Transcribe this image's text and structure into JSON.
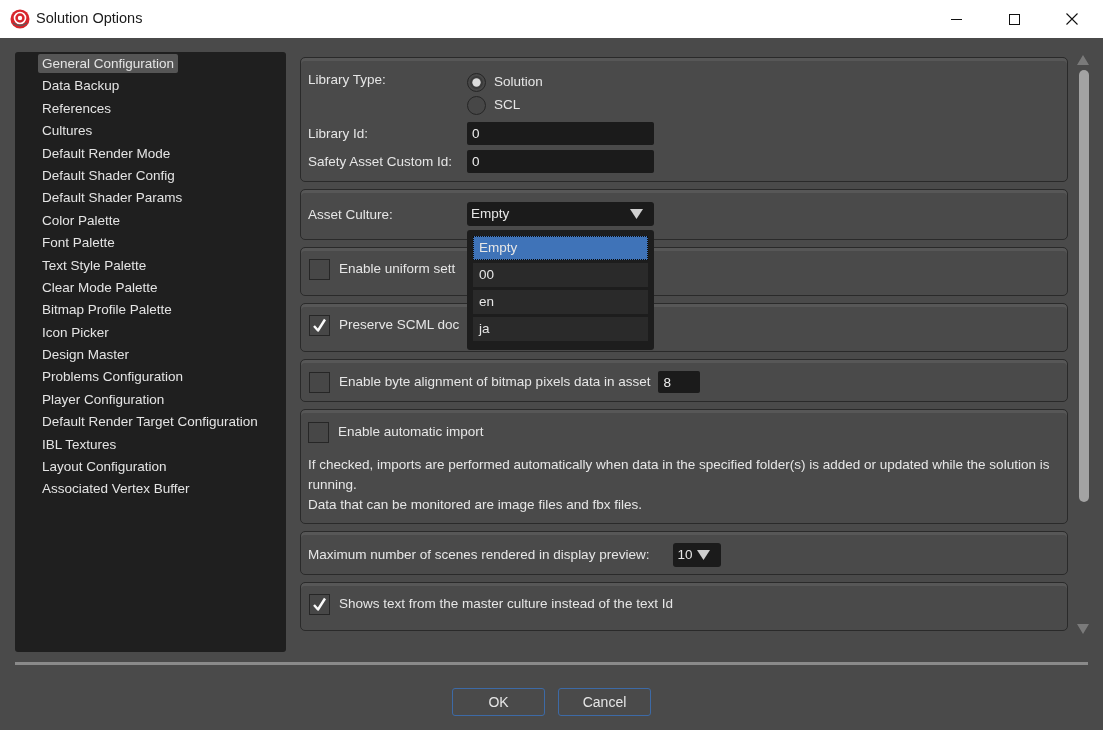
{
  "window": {
    "title": "Solution Options"
  },
  "sidebar": {
    "items": [
      {
        "label": "General Configuration",
        "selected": true
      },
      {
        "label": "Data Backup",
        "selected": false
      },
      {
        "label": "References",
        "selected": false
      },
      {
        "label": "Cultures",
        "selected": false
      },
      {
        "label": "Default Render Mode",
        "selected": false
      },
      {
        "label": "Default Shader Config",
        "selected": false
      },
      {
        "label": "Default Shader Params",
        "selected": false
      },
      {
        "label": "Color Palette",
        "selected": false
      },
      {
        "label": "Font Palette",
        "selected": false
      },
      {
        "label": "Text Style Palette",
        "selected": false
      },
      {
        "label": "Clear Mode Palette",
        "selected": false
      },
      {
        "label": "Bitmap Profile Palette",
        "selected": false
      },
      {
        "label": "Icon Picker",
        "selected": false
      },
      {
        "label": "Design Master",
        "selected": false
      },
      {
        "label": "Problems Configuration",
        "selected": false
      },
      {
        "label": "Player Configuration",
        "selected": false
      },
      {
        "label": "Default Render Target Configuration",
        "selected": false
      },
      {
        "label": "IBL Textures",
        "selected": false
      },
      {
        "label": "Layout Configuration",
        "selected": false
      },
      {
        "label": "Associated Vertex Buffer",
        "selected": false
      }
    ]
  },
  "panels": [
    {
      "kind": "form",
      "rows": [
        {
          "kind": "radio",
          "label": "Library Type:",
          "options": [
            {
              "label": "Solution",
              "selected": true
            },
            {
              "label": "SCL",
              "selected": false
            }
          ]
        },
        {
          "kind": "input",
          "label": "Library Id:",
          "value": "0"
        },
        {
          "kind": "input",
          "label": "Safety Asset Custom Id:",
          "value": "0"
        }
      ]
    },
    {
      "kind": "form",
      "rows": [
        {
          "kind": "combo",
          "label": "Asset Culture:",
          "value": "Empty",
          "expanded": true,
          "options": [
            {
              "label": "Empty",
              "selected": true
            },
            {
              "label": "00",
              "selected": false
            },
            {
              "label": "en",
              "selected": false
            },
            {
              "label": "ja",
              "selected": false
            }
          ]
        }
      ]
    },
    {
      "kind": "checkbox",
      "label": "Enable uniform sett",
      "checked": false
    },
    {
      "kind": "checkbox",
      "label": "Preserve SCML doc",
      "checked": true
    },
    {
      "kind": "checkbox",
      "label": "Enable byte alignment of bitmap pixels data in asset",
      "checked": false,
      "value": "8"
    },
    {
      "kind": "checkbox",
      "label": "Enable automatic import",
      "checked": false,
      "description": [
        "If checked, imports are performed automatically when data in the specified folder(s) is added or updated while the solution is running.",
        "Data that can be monitored are image files and fbx files."
      ]
    },
    {
      "kind": "choice",
      "label": "Maximum number of scenes rendered in display preview:",
      "value": "10",
      "expanded": false
    },
    {
      "kind": "checkbox",
      "label": "Shows text from the master culture instead of the text Id",
      "checked": true
    }
  ],
  "buttons": [
    {
      "label": "OK"
    },
    {
      "label": "Cancel"
    }
  ]
}
